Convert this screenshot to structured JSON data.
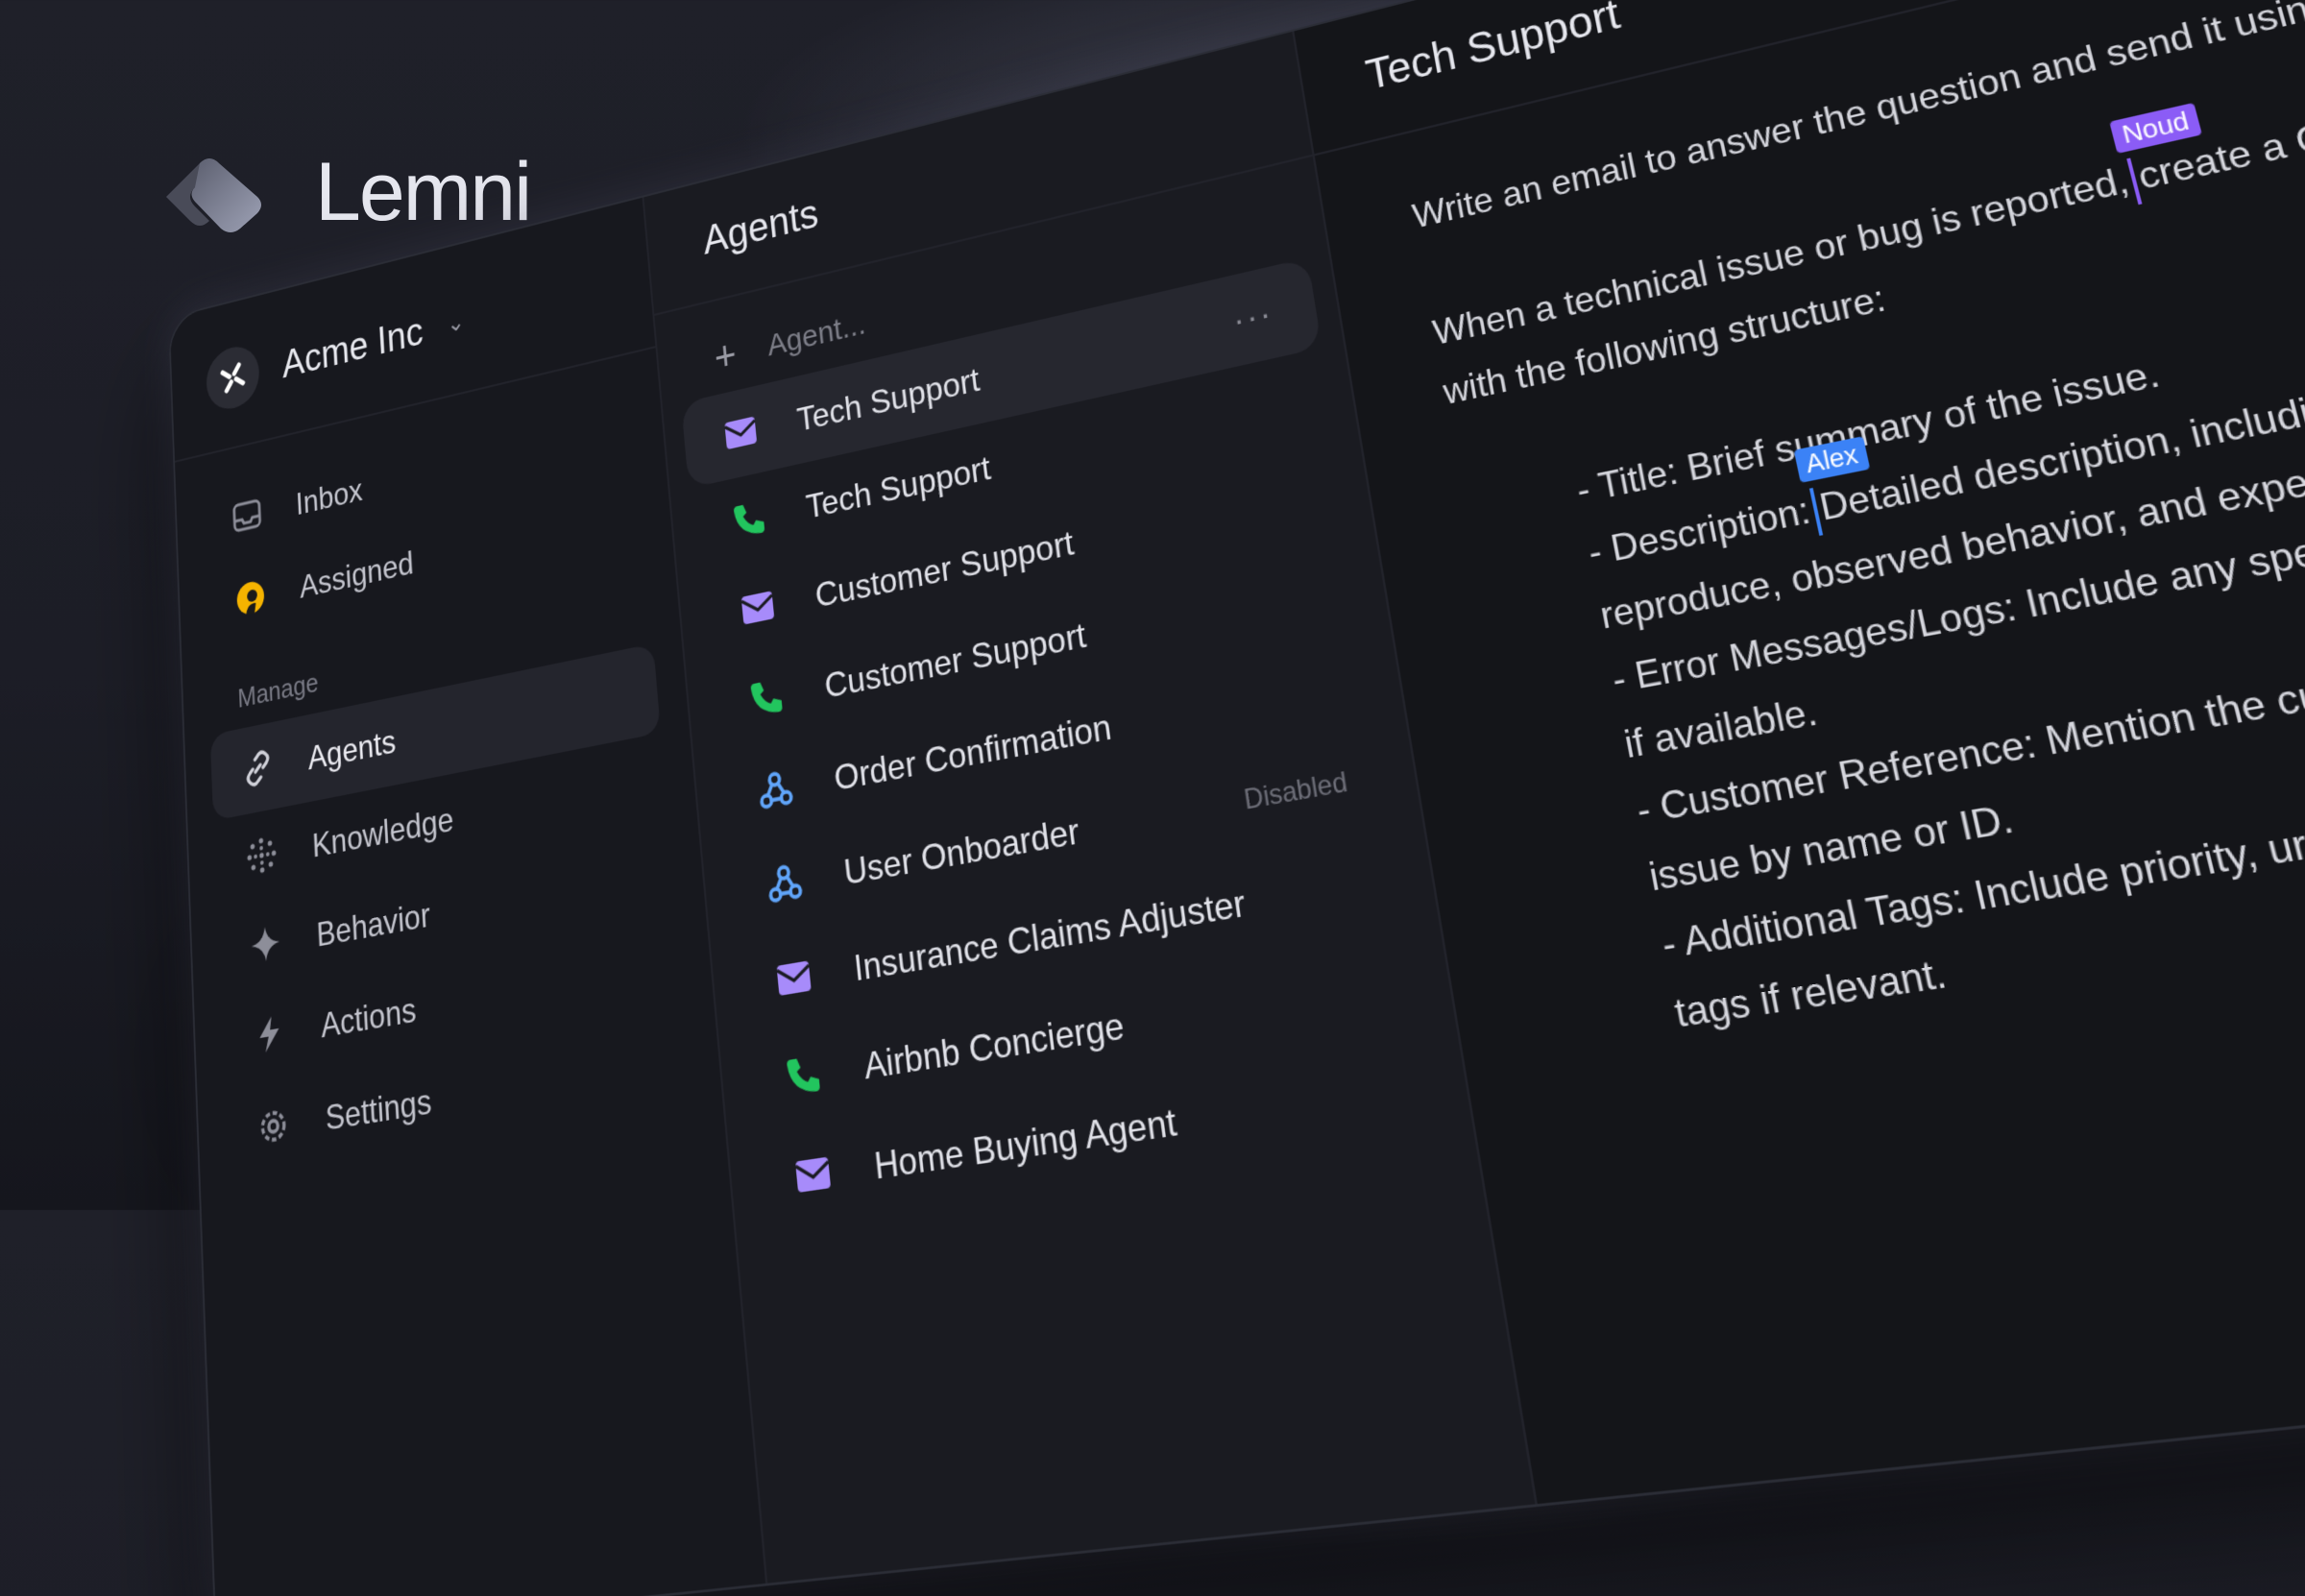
{
  "brand": {
    "name": "Lemni"
  },
  "workspace": {
    "name": "Acme Inc"
  },
  "sidebar": {
    "top_items": [
      {
        "label": "Inbox",
        "icon": "inbox-icon"
      },
      {
        "label": "Assigned",
        "icon": "avatar"
      }
    ],
    "section_label": "Manage",
    "manage_items": [
      {
        "label": "Agents",
        "icon": "link-icon",
        "active": true
      },
      {
        "label": "Knowledge",
        "icon": "dots-circle-icon"
      },
      {
        "label": "Behavior",
        "icon": "sparkle-icon"
      },
      {
        "label": "Actions",
        "icon": "bolt-icon"
      },
      {
        "label": "Settings",
        "icon": "gear-icon"
      }
    ]
  },
  "agents_panel": {
    "title": "Agents",
    "add_placeholder": "Agent...",
    "more_label": "···",
    "items": [
      {
        "label": "Tech Support",
        "type": "email",
        "selected": true
      },
      {
        "label": "Tech Support",
        "type": "phone"
      },
      {
        "label": "Customer Support",
        "type": "email"
      },
      {
        "label": "Customer Support",
        "type": "phone"
      },
      {
        "label": "Order Confirmation",
        "type": "webhook"
      },
      {
        "label": "User Onboarder",
        "type": "webhook",
        "status": "Disabled"
      },
      {
        "label": "Insurance Claims Adjuster",
        "type": "email"
      },
      {
        "label": "Airbnb Concierge",
        "type": "phone"
      },
      {
        "label": "Home Buying Agent",
        "type": "email"
      }
    ]
  },
  "editor": {
    "title": "Tech Support",
    "toolbar": [
      "email-icon",
      "openai-icon",
      "dots-circle-icon",
      "sparkle-icon"
    ],
    "line1": "Write an email to answer the question and send it using gmail.",
    "line2_before": "When a technical issue or bug is reported,",
    "line2_after": "create a GitHub issue",
    "line3": "with the following structure:",
    "title_before": "- Title: Brief su",
    "title_after": "mmary of the issue.",
    "desc_before": "- Description:",
    "desc_after": "Detailed description, including steps to",
    "desc_cont": "reproduce, observed behavior, and expected outcome.",
    "errors": "- Error Messages/Logs: Include any specific messages",
    "errors_cont": "if available.",
    "customer": "- Customer Reference: Mention the customer experiencing the",
    "customer_cont": "issue by name or ID.",
    "tags": "- Additional Tags: Include priority, urgency, or other",
    "tags_cont": "tags if relevant.",
    "cursors": {
      "noud": "Noud",
      "alex": "Alex"
    }
  },
  "colors": {
    "email": "#a78bfa",
    "phone": "#22c55e",
    "webhook": "#60a5fa",
    "cursor_noud": "#8b5cf6",
    "cursor_alex": "#3b82f6",
    "avatar": "#f5b300"
  }
}
